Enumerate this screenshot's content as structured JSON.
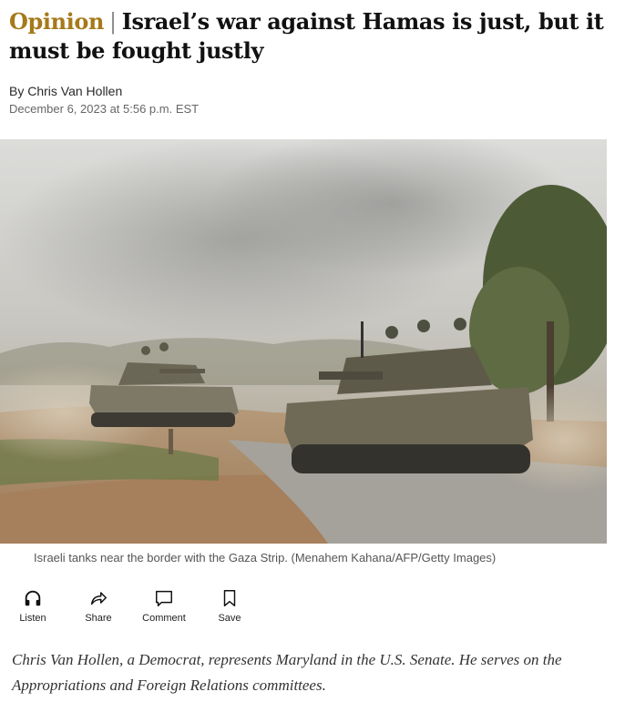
{
  "article": {
    "kicker": "Opinion",
    "separator": "|",
    "title": "Israel’s war against Hamas is just, but it must be fought justly",
    "byline_prefix": "By",
    "author": "Chris Van Hollen",
    "date": "December 6, 2023 at 5:56 p.m. EST"
  },
  "photo": {
    "caption": "Israeli tanks near the border with the Gaza Strip. (Menahem Kahana/AFP/Getty Images)"
  },
  "actions": [
    {
      "label": "Listen",
      "icon": "headphones-icon"
    },
    {
      "label": "Share",
      "icon": "share-arrow-icon"
    },
    {
      "label": "Comment",
      "icon": "comment-bubble-icon"
    },
    {
      "label": "Save",
      "icon": "bookmark-icon"
    }
  ],
  "bio": "Chris Van Hollen, a Democrat, represents Maryland in the U.S. Senate. He serves on the Appropriations and Foreign Relations committees.",
  "colors": {
    "kicker": "#a6791a",
    "text": "#111111",
    "meta": "#666666"
  }
}
